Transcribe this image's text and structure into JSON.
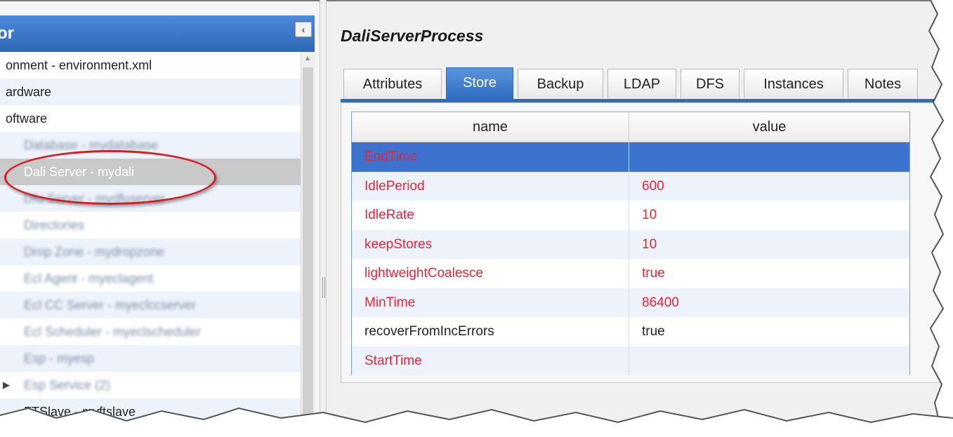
{
  "navigator": {
    "title": "or",
    "collapse_icon": "chevron-left-icon",
    "collapse_glyph": "‹",
    "items": [
      {
        "label": "onment - environment.xml",
        "indent": 8,
        "blurred": false,
        "selected": false
      },
      {
        "label": "ardware",
        "indent": 8,
        "blurred": false,
        "selected": false
      },
      {
        "label": "oftware",
        "indent": 8,
        "blurred": false,
        "selected": false
      },
      {
        "label": "Database - mydatabase",
        "indent": 34,
        "blurred": true,
        "selected": false
      },
      {
        "label": "Dali Server - mydali",
        "indent": 34,
        "blurred": false,
        "selected": true
      },
      {
        "label": "Dfu Server - mydfuserver",
        "indent": 34,
        "blurred": true,
        "selected": false
      },
      {
        "label": "Directories",
        "indent": 34,
        "blurred": true,
        "selected": false
      },
      {
        "label": "Drop Zone - mydropzone",
        "indent": 34,
        "blurred": true,
        "selected": false
      },
      {
        "label": "Ecl Agent - myeclagent",
        "indent": 34,
        "blurred": true,
        "selected": false
      },
      {
        "label": "Ecl CC Server - myeclccserver",
        "indent": 34,
        "blurred": true,
        "selected": false
      },
      {
        "label": "Ecl Scheduler - myeclscheduler",
        "indent": 34,
        "blurred": true,
        "selected": false
      },
      {
        "label": "Esp - myesp",
        "indent": 34,
        "blurred": true,
        "selected": false
      },
      {
        "label": "Esp Service (2)",
        "indent": 34,
        "blurred": true,
        "selected": false,
        "expander": "▶"
      },
      {
        "label": "FTSlave - myftslave",
        "indent": 34,
        "blurred": false,
        "selected": false
      }
    ]
  },
  "detail": {
    "title": "DaliServerProcess",
    "tabs": [
      {
        "label": "Attributes",
        "active": false
      },
      {
        "label": "Store",
        "active": true
      },
      {
        "label": "Backup",
        "active": false
      },
      {
        "label": "LDAP",
        "active": false
      },
      {
        "label": "DFS",
        "active": false
      },
      {
        "label": "Instances",
        "active": false
      },
      {
        "label": "Notes",
        "active": false
      }
    ],
    "grid": {
      "columns": [
        "name",
        "value"
      ],
      "rows": [
        {
          "name": "EndTime",
          "value": "",
          "name_color": "red",
          "selected": true
        },
        {
          "name": "IdlePeriod",
          "value": "600",
          "name_color": "red"
        },
        {
          "name": "IdleRate",
          "value": "10",
          "name_color": "red"
        },
        {
          "name": "keepStores",
          "value": "10",
          "name_color": "red"
        },
        {
          "name": "lightweightCoalesce",
          "value": "true",
          "name_color": "red"
        },
        {
          "name": "MinTime",
          "value": "86400",
          "name_color": "red"
        },
        {
          "name": "recoverFromIncErrors",
          "value": "true",
          "name_color": "black"
        },
        {
          "name": "StartTime",
          "value": "",
          "name_color": "red"
        }
      ]
    }
  },
  "colors": {
    "accent": "#2f6cc0",
    "modified_text": "#e8253a",
    "annotation": "#d61f26"
  }
}
